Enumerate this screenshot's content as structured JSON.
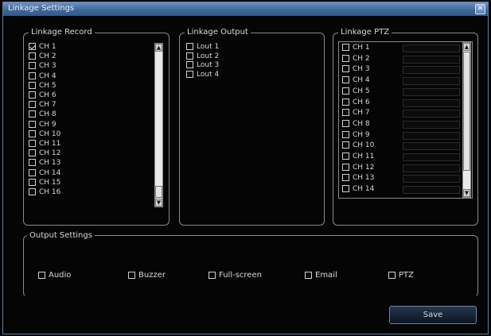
{
  "window": {
    "title": "Linkage Settings",
    "close_icon": "close-icon"
  },
  "linkage_record": {
    "title": "Linkage Record",
    "channels": [
      {
        "label": "CH  1",
        "checked": true
      },
      {
        "label": "CH  2",
        "checked": false
      },
      {
        "label": "CH  3",
        "checked": false
      },
      {
        "label": "CH  4",
        "checked": false
      },
      {
        "label": "CH  5",
        "checked": false
      },
      {
        "label": "CH  6",
        "checked": false
      },
      {
        "label": "CH  7",
        "checked": false
      },
      {
        "label": "CH  8",
        "checked": false
      },
      {
        "label": "CH  9",
        "checked": false
      },
      {
        "label": "CH 10",
        "checked": false
      },
      {
        "label": "CH 11",
        "checked": false
      },
      {
        "label": "CH 12",
        "checked": false
      },
      {
        "label": "CH 13",
        "checked": false
      },
      {
        "label": "CH 14",
        "checked": false
      },
      {
        "label": "CH 15",
        "checked": false
      },
      {
        "label": "CH 16",
        "checked": false
      }
    ]
  },
  "linkage_output": {
    "title": "Linkage Output",
    "outputs": [
      {
        "label": "Lout 1",
        "checked": false
      },
      {
        "label": "Lout 2",
        "checked": false
      },
      {
        "label": "Lout 3",
        "checked": false
      },
      {
        "label": "Lout 4",
        "checked": false
      }
    ]
  },
  "linkage_ptz": {
    "title": "Linkage PTZ",
    "channels": [
      {
        "label": "CH  1"
      },
      {
        "label": "CH  2"
      },
      {
        "label": "CH  3"
      },
      {
        "label": "CH  4"
      },
      {
        "label": "CH  5"
      },
      {
        "label": "CH  6"
      },
      {
        "label": "CH  7"
      },
      {
        "label": "CH  8"
      },
      {
        "label": "CH  9"
      },
      {
        "label": "CH 10"
      },
      {
        "label": "CH 11"
      },
      {
        "label": "CH 12"
      },
      {
        "label": "CH 13"
      },
      {
        "label": "CH 14"
      }
    ]
  },
  "output_settings": {
    "title": "Output Settings",
    "options": [
      {
        "label": "Audio",
        "checked": false
      },
      {
        "label": "Buzzer",
        "checked": false
      },
      {
        "label": "Full-screen",
        "checked": false
      },
      {
        "label": "Email",
        "checked": false
      },
      {
        "label": "PTZ",
        "checked": false
      }
    ]
  },
  "buttons": {
    "save": "Save"
  },
  "colors": {
    "title_bar": "#3f6799",
    "background": "#050505",
    "border": "#8a8a8a"
  }
}
